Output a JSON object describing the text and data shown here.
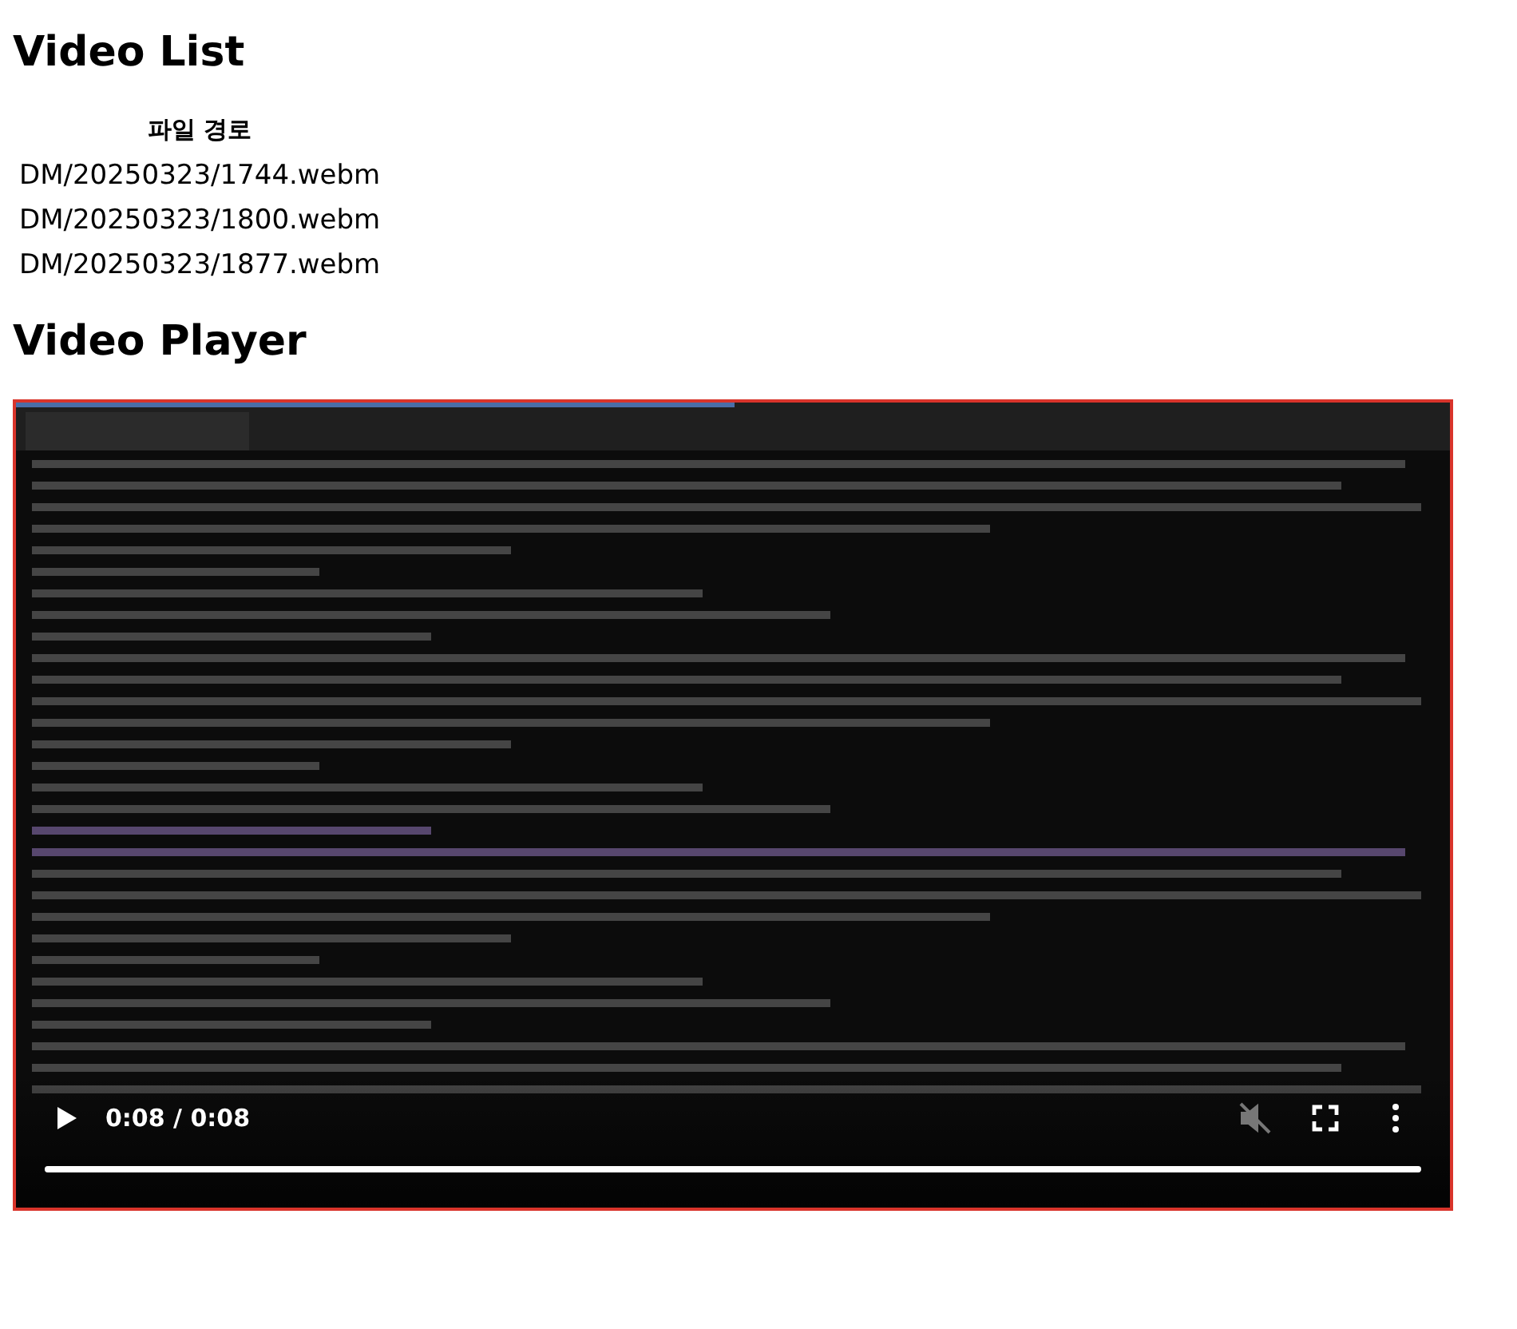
{
  "list_heading": "Video List",
  "table": {
    "columns": [
      "파일 경로"
    ],
    "rows": [
      [
        "DM/20250323/1744.webm"
      ],
      [
        "DM/20250323/1800.webm"
      ],
      [
        "DM/20250323/1877.webm"
      ]
    ]
  },
  "player_heading": "Video Player",
  "player": {
    "kind": "picture",
    "playing": false,
    "time": "0:08 / 0:08",
    "muted": true,
    "progress": {
      "level": 1
    }
  }
}
